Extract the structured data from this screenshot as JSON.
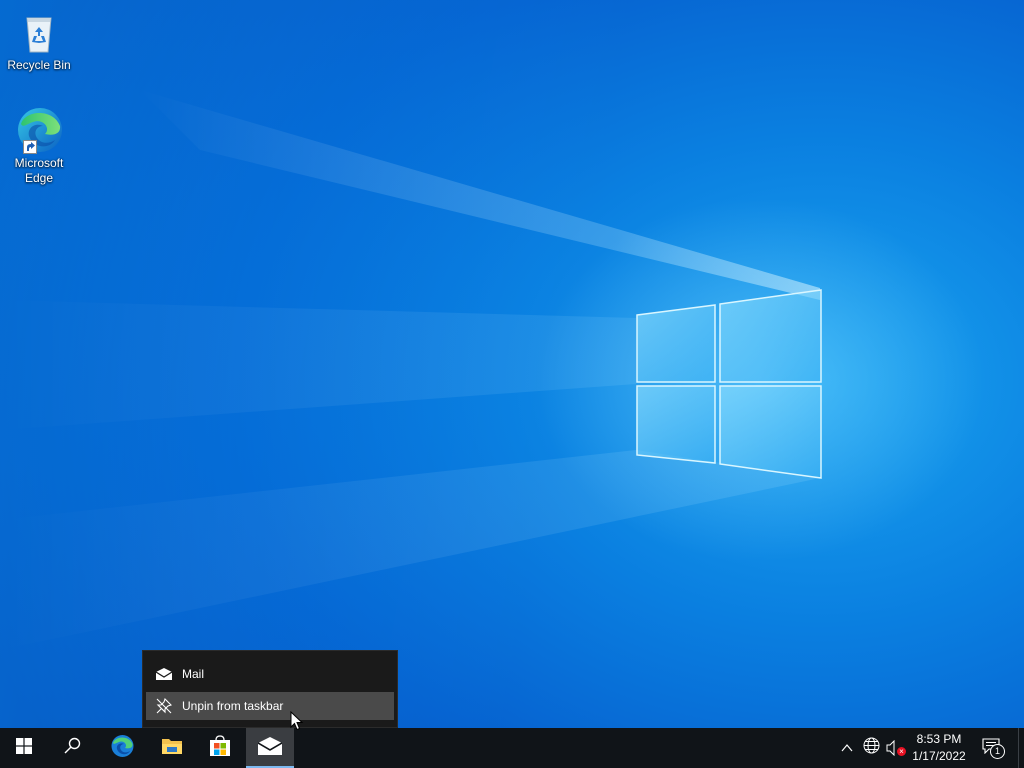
{
  "desktop": {
    "icons": [
      {
        "label": "Recycle Bin",
        "icon": "recycle-bin-icon"
      },
      {
        "label": "Microsoft Edge",
        "icon": "edge-icon",
        "shortcut": true
      }
    ]
  },
  "jumplist": {
    "app_title": "Mail",
    "items": [
      {
        "label": "Unpin from taskbar",
        "icon": "unpin-icon",
        "highlighted": true
      }
    ]
  },
  "taskbar": {
    "buttons": [
      {
        "name": "start",
        "icon": "windows-logo-icon"
      },
      {
        "name": "search",
        "icon": "search-icon"
      },
      {
        "name": "edge",
        "icon": "edge-icon"
      },
      {
        "name": "file-explorer",
        "icon": "folder-icon"
      },
      {
        "name": "store",
        "icon": "store-icon"
      },
      {
        "name": "mail",
        "icon": "mail-icon",
        "active": true
      }
    ],
    "tray": {
      "icons": [
        "chevron-up-icon",
        "network-globe-icon",
        "volume-muted-icon"
      ],
      "time": "8:53 PM",
      "date": "1/17/2022",
      "notification_count": "1"
    }
  },
  "colors": {
    "taskbar_bg": "#101418",
    "menu_bg": "#1a1a1a",
    "menu_hover": "#4a4a4a",
    "accent": "#0a7fe0"
  }
}
